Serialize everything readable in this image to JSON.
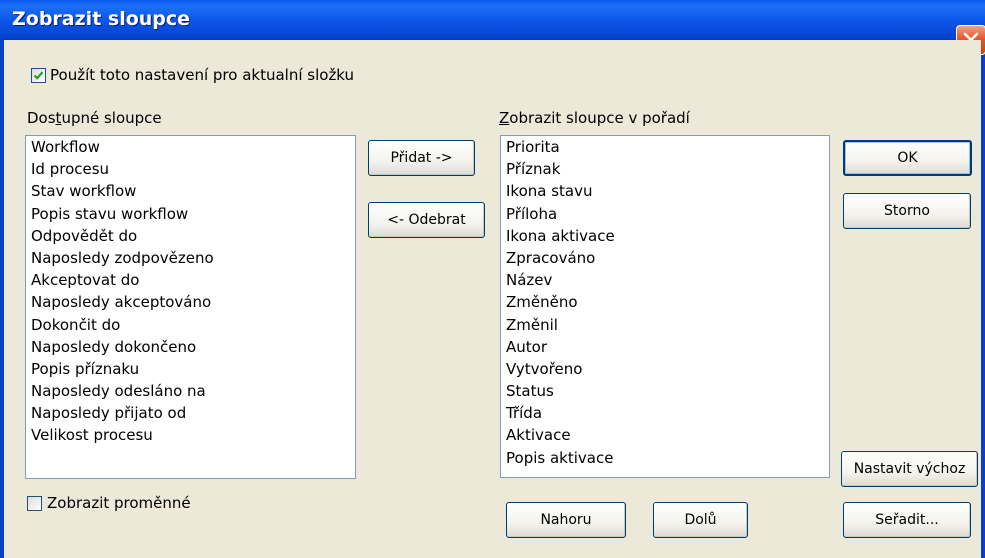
{
  "window": {
    "title": "Zobrazit sloupce",
    "close_icon": "close-icon"
  },
  "use_for_folder": {
    "label": "Použít toto nastavení pro aktualní složku",
    "checked": true
  },
  "available": {
    "label_before": "Dos",
    "label_mnemonic": "t",
    "label_after": "upné sloupce",
    "items": [
      "Workflow",
      "Id procesu",
      "Stav workflow",
      "Popis stavu workflow",
      "Odpovědět do",
      "Naposledy zodpovězeno",
      "Akceptovat do",
      "Naposledy akceptováno",
      "Dokončit do",
      "Naposledy dokončeno",
      "Popis příznaku",
      "Naposledy odesláno na",
      "Naposledy přijato od",
      "Velikost procesu"
    ]
  },
  "displayed": {
    "label_mnemonic": "Z",
    "label_after": "obrazit sloupce v pořadí",
    "items": [
      "Priorita",
      "Příznak",
      "Ikona stavu",
      "Příloha",
      "Ikona aktivace",
      "Zpracováno",
      "Název",
      "Změněno",
      "Změnil",
      "Autor",
      "Vytvořeno",
      "Status",
      "Třída",
      "Aktivace",
      "Popis aktivace"
    ]
  },
  "show_variables": {
    "label": "Zobrazit proměnné",
    "checked": false
  },
  "buttons": {
    "add": "Přidat ->",
    "remove": "<- Odebrat",
    "ok": "OK",
    "cancel": "Storno",
    "set_default": "Nastavit výchoz",
    "up": "Nahoru",
    "down": "Dolů",
    "sort": "Seřadit..."
  },
  "colors": {
    "titlebar": "#0b5bf0",
    "dialog_bg": "#ece9d8",
    "check": "#21a121",
    "close": "#e3582f"
  }
}
